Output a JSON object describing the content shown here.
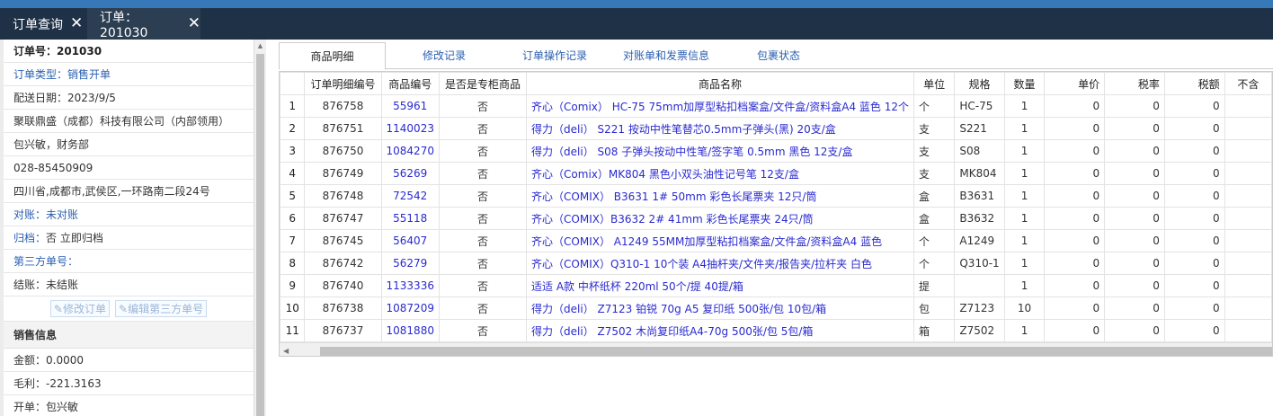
{
  "tabs": [
    {
      "label": "订单查询",
      "active": false
    },
    {
      "label": "订单：201030",
      "active": true
    }
  ],
  "order_info": {
    "order_no_label": "订单号：201030",
    "type_key": "订单类型：",
    "type_value": "销售开单",
    "ship_date": "配送日期：2023/9/5",
    "company": "聚联鼎盛（成都）科技有限公司（内部领用）",
    "contact": "包兴敏，财务部",
    "phone": "028-85450909",
    "address": "四川省,成都市,武侯区,一环路南二段24号",
    "reconcile_key": "对账：",
    "reconcile_value": "未对账",
    "archive_key": "归档：",
    "archive_value": "否 立即归档",
    "third_party_key": "第三方单号：",
    "settle": "结账：未结账",
    "edit_order_btn": "修改订单",
    "edit_third_btn": "编辑第三方单号"
  },
  "sales_info": {
    "header": "销售信息",
    "amount": "金额：0.0000",
    "profit": "毛利：-221.3163",
    "creator": "开单：包兴敏"
  },
  "subtabs": [
    "商品明细",
    "修改记录",
    "订单操作记录",
    "对账单和发票信息",
    "包裹状态"
  ],
  "grid": {
    "columns": [
      "",
      "订单明细编号",
      "商品编号",
      "是否是专柜商品",
      "商品名称",
      "单位",
      "规格",
      "数量",
      "单价",
      "税率",
      "税额",
      "不含"
    ],
    "rows": [
      [
        "1",
        "876758",
        "55961",
        "否",
        "齐心（Comix） HC-75 75mm加厚型粘扣档案盒/文件盒/资料盒A4 蓝色 12个",
        "个",
        "HC-75",
        "1",
        "0",
        "0",
        "0"
      ],
      [
        "2",
        "876751",
        "1140023",
        "否",
        "得力（deli） S221 按动中性笔替芯0.5mm子弹头(黑) 20支/盒",
        "支",
        "S221",
        "1",
        "0",
        "0",
        "0"
      ],
      [
        "3",
        "876750",
        "1084270",
        "否",
        "得力（deli） S08 子弹头按动中性笔/签字笔 0.5mm 黑色 12支/盒",
        "支",
        "S08",
        "1",
        "0",
        "0",
        "0"
      ],
      [
        "4",
        "876749",
        "56269",
        "否",
        "齐心（Comix）MK804 黑色小双头油性记号笔 12支/盒",
        "支",
        "MK804",
        "1",
        "0",
        "0",
        "0"
      ],
      [
        "5",
        "876748",
        "72542",
        "否",
        "齐心（COMIX） B3631 1# 50mm 彩色长尾票夹 12只/筒",
        "盒",
        "B3631",
        "1",
        "0",
        "0",
        "0"
      ],
      [
        "6",
        "876747",
        "55118",
        "否",
        "齐心（COMIX）B3632 2# 41mm 彩色长尾票夹 24只/筒",
        "盒",
        "B3632",
        "1",
        "0",
        "0",
        "0"
      ],
      [
        "7",
        "876745",
        "56407",
        "否",
        "齐心（COMIX） A1249 55MM加厚型粘扣档案盒/文件盒/资料盒A4 蓝色",
        "个",
        "A1249",
        "1",
        "0",
        "0",
        "0"
      ],
      [
        "8",
        "876742",
        "56279",
        "否",
        "齐心（COMIX）Q310-1 10个装 A4抽杆夹/文件夹/报告夹/拉杆夹 白色",
        "个",
        "Q310-1",
        "1",
        "0",
        "0",
        "0"
      ],
      [
        "9",
        "876740",
        "1133336",
        "否",
        "适适 A款 中杯纸杯 220ml 50个/提 40提/箱",
        "提",
        "",
        "1",
        "0",
        "0",
        "0"
      ],
      [
        "10",
        "876738",
        "1087209",
        "否",
        "得力（deli） Z7123 铂锐 70g A5 复印纸 500张/包 10包/箱",
        "包",
        "Z7123",
        "10",
        "0",
        "0",
        "0"
      ],
      [
        "11",
        "876737",
        "1081880",
        "否",
        "得力（deli） Z7502 木尚复印纸A4-70g 500张/包 5包/箱",
        "箱",
        "Z7502",
        "1",
        "0",
        "0",
        "0"
      ]
    ]
  }
}
